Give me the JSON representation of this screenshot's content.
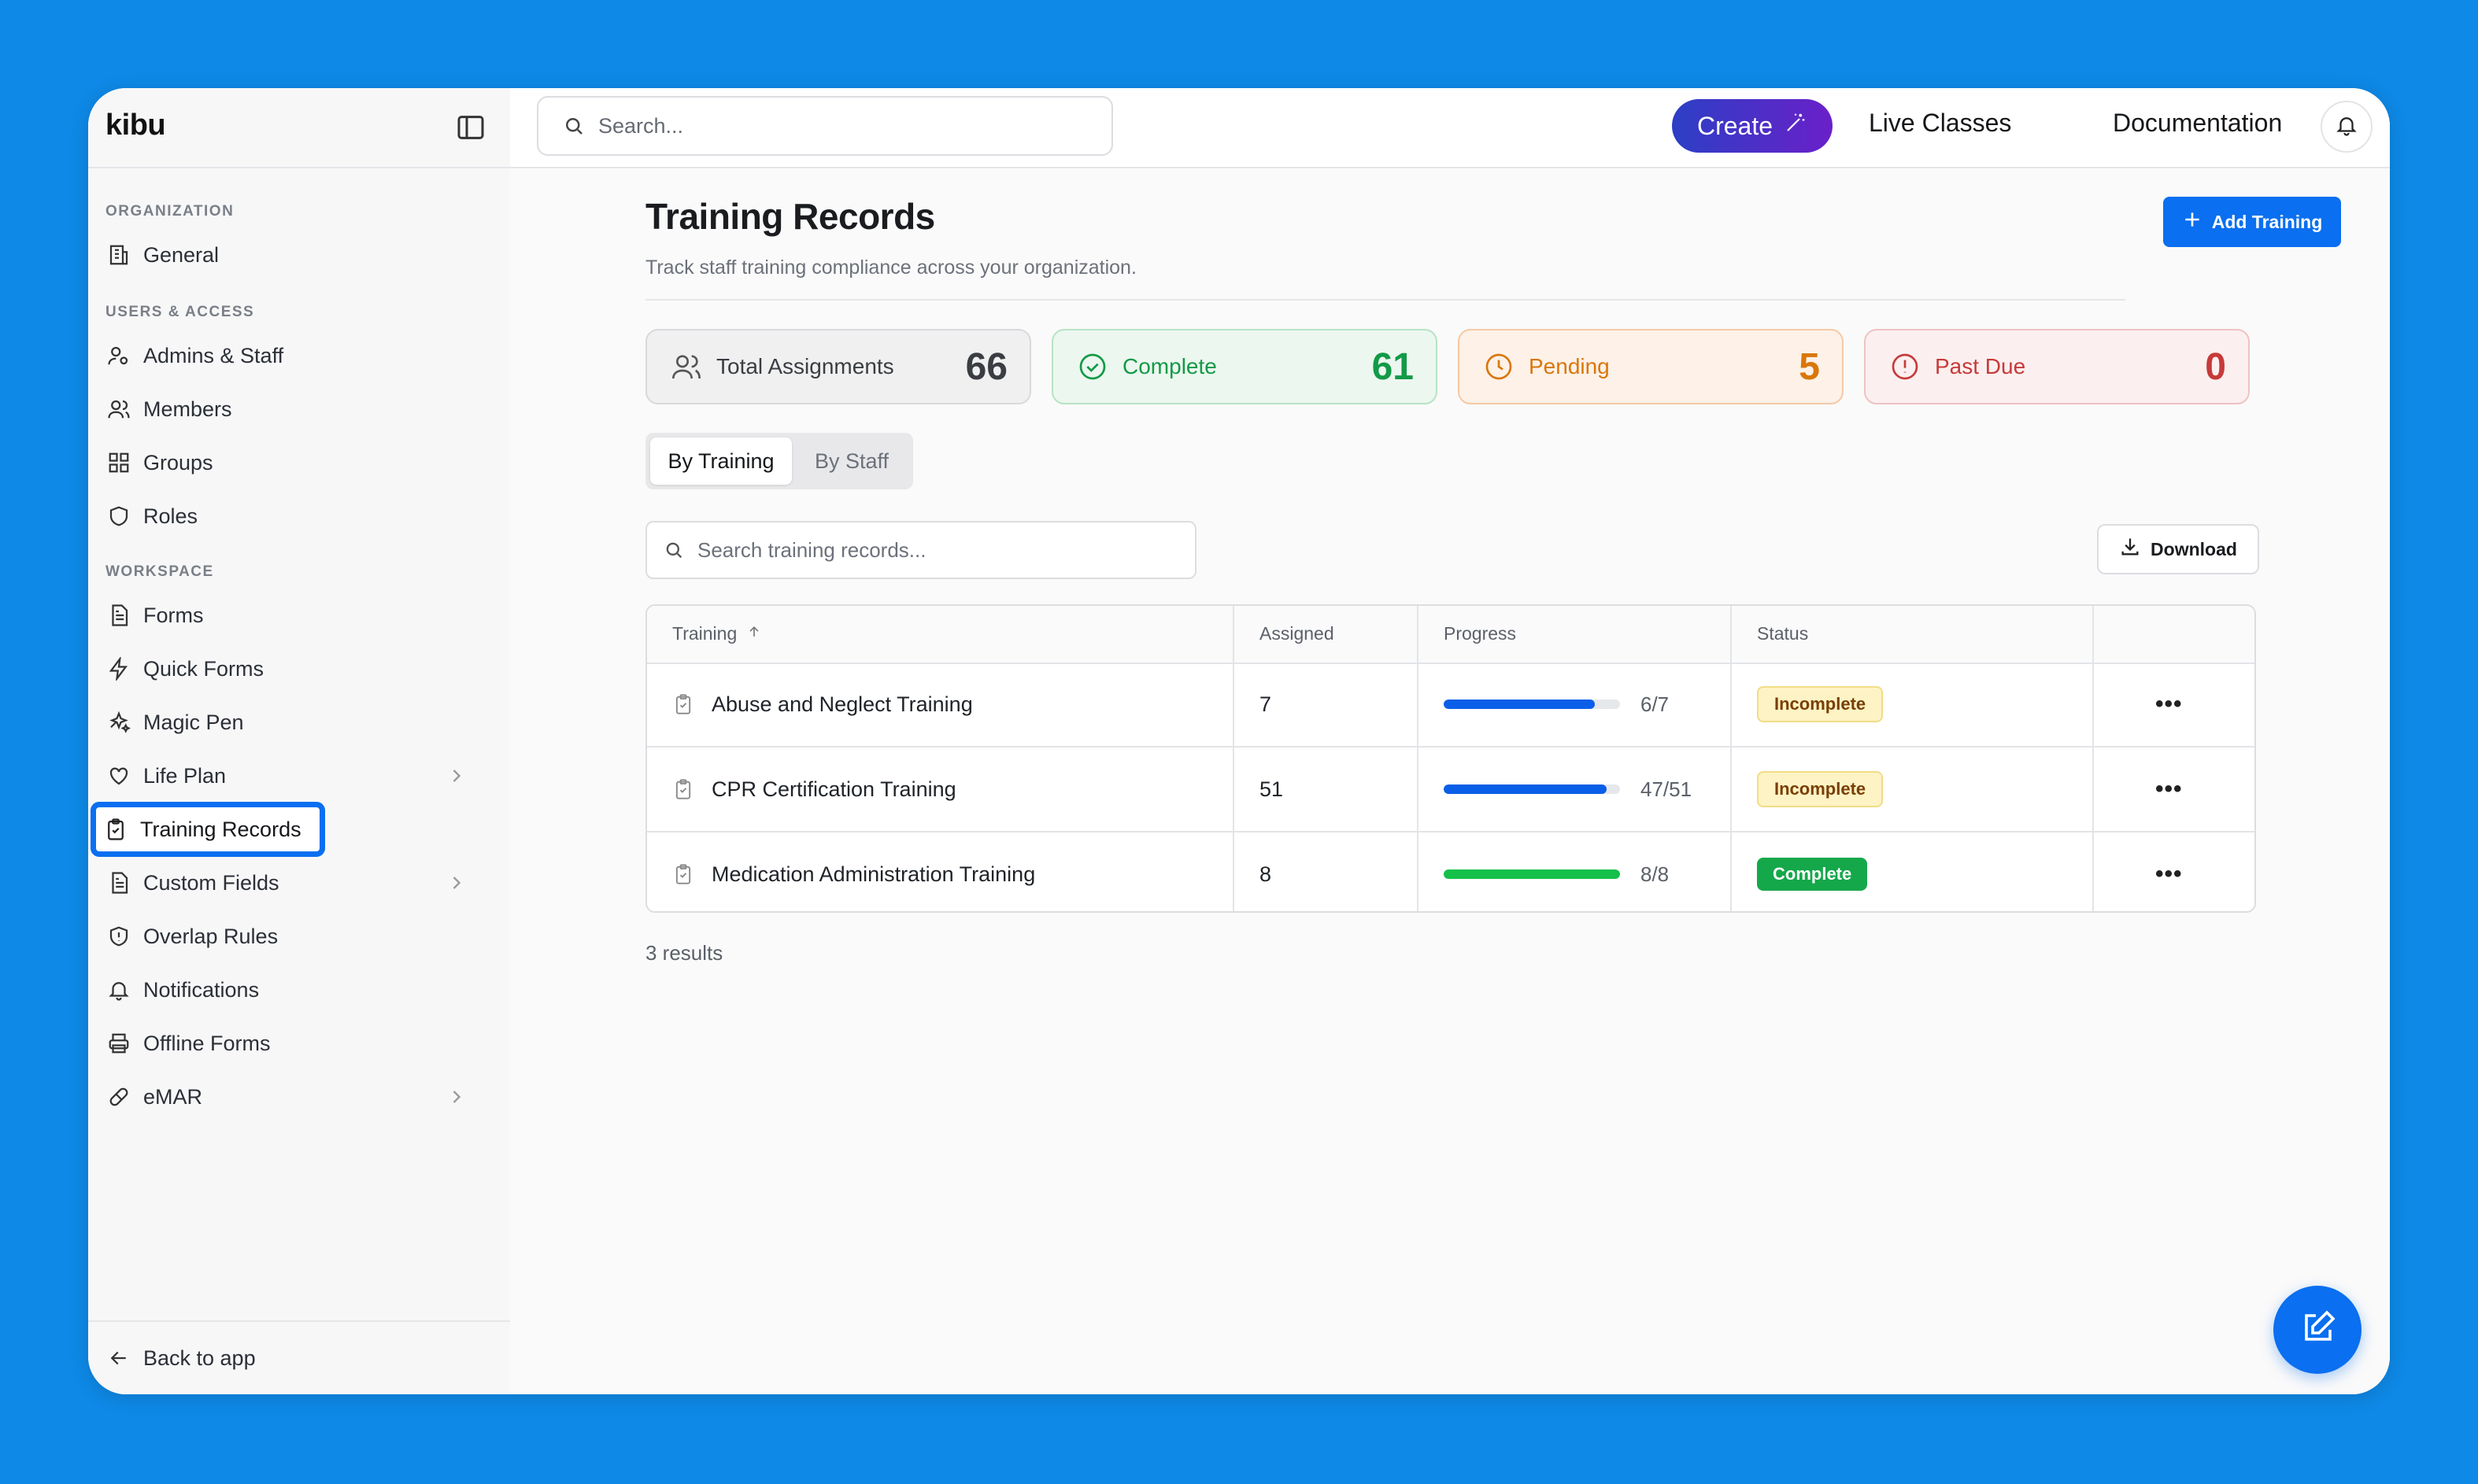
{
  "app": {
    "logo": "kibu"
  },
  "topbar": {
    "search_placeholder": "Search...",
    "create_label": "Create",
    "live_classes": "Live Classes",
    "documentation": "Documentation"
  },
  "sidebar": {
    "sections": [
      "ORGANIZATION",
      "USERS & ACCESS",
      "WORKSPACE"
    ],
    "items": [
      {
        "label": "General",
        "icon": "building-icon"
      },
      {
        "label": "Admins & Staff",
        "icon": "user-gear-icon"
      },
      {
        "label": "Members",
        "icon": "users-icon"
      },
      {
        "label": "Groups",
        "icon": "grid-icon"
      },
      {
        "label": "Roles",
        "icon": "shield-icon"
      },
      {
        "label": "Forms",
        "icon": "file-text-icon"
      },
      {
        "label": "Quick Forms",
        "icon": "lightning-icon"
      },
      {
        "label": "Magic Pen",
        "icon": "sparkles-icon"
      },
      {
        "label": "Life Plan",
        "icon": "heart-icon"
      },
      {
        "label": "Training Records",
        "icon": "clipboard-check-icon"
      },
      {
        "label": "Custom Fields",
        "icon": "file-text-icon"
      },
      {
        "label": "Overlap Rules",
        "icon": "shield-alert-icon"
      },
      {
        "label": "Notifications",
        "icon": "bell-icon"
      },
      {
        "label": "Offline Forms",
        "icon": "printer-icon"
      },
      {
        "label": "eMAR",
        "icon": "pill-icon"
      }
    ],
    "back_label": "Back to app"
  },
  "page": {
    "title": "Training Records",
    "subtitle": "Track staff training compliance across your organization.",
    "add_button": "Add Training"
  },
  "stats": [
    {
      "label": "Total Assignments",
      "value": "66",
      "color": "#3a3d42"
    },
    {
      "label": "Complete",
      "value": "61",
      "color": "#139a47"
    },
    {
      "label": "Pending",
      "value": "5",
      "color": "#d9770a"
    },
    {
      "label": "Past Due",
      "value": "0",
      "color": "#c63a3a"
    }
  ],
  "tabs": {
    "by_training": "By Training",
    "by_staff": "By Staff"
  },
  "table_search_placeholder": "Search training records...",
  "download_label": "Download",
  "table": {
    "headers": {
      "training": "Training",
      "assigned": "Assigned",
      "progress": "Progress",
      "status": "Status"
    },
    "rows": [
      {
        "name": "Abuse and Neglect Training",
        "assigned": "7",
        "progress_text": "6/7",
        "progress": 0.857,
        "bar_color": "#0a5fe8",
        "status": "Incomplete"
      },
      {
        "name": "CPR Certification Training",
        "assigned": "51",
        "progress_text": "47/51",
        "progress": 0.922,
        "bar_color": "#0a5fe8",
        "status": "Incomplete"
      },
      {
        "name": "Medication Administration Training",
        "assigned": "8",
        "progress_text": "8/8",
        "progress": 1.0,
        "bar_color": "#14c04a",
        "status": "Complete"
      }
    ]
  },
  "results_text": "3 results"
}
